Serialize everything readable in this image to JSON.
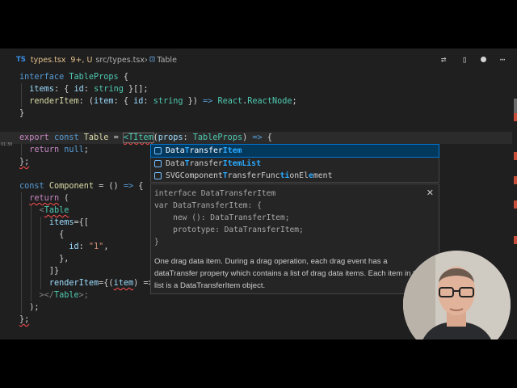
{
  "colors": {
    "editor_bg": "#1f1f1f",
    "keyword": "#569cd6",
    "type": "#4ec9b0",
    "selection": "#04395e",
    "error_marker": "#c74e39"
  },
  "breadcrumb": {
    "lang_badge": "TS",
    "filename": "types.tsx",
    "status": "9+, U",
    "path": "src/types.tsx",
    "separator": "›",
    "symbol_icon": "⊡",
    "symbol": "Table"
  },
  "tab_actions": [
    {
      "name": "compare-changes-icon",
      "glyph": "⇄"
    },
    {
      "name": "split-editor-icon",
      "glyph": "▯"
    },
    {
      "name": "unsaved-dot-icon",
      "glyph": ""
    },
    {
      "name": "more-actions-icon",
      "glyph": "⋯"
    }
  ],
  "code": {
    "l1": {
      "kw": "interface",
      "sp": " ",
      "name": "TableProps",
      "rest": " {"
    },
    "l2": {
      "indent": "  ",
      "p": "items",
      "t1": ": { ",
      "p2": "id",
      "t2": ": ",
      "ty": "string",
      "t3": " }[];"
    },
    "l3": {
      "indent": "  ",
      "fn": "renderItem",
      "t1": ": (",
      "p": "item",
      "t2": ": { ",
      "p2": "id",
      "t3": ": ",
      "ty": "string",
      "t4": " }) ",
      "arrow": "=>",
      "t5": " ",
      "ns": "React",
      "dot": ".",
      "rn": "ReactNode",
      "end": ";"
    },
    "l4": {
      "text": "}"
    },
    "l5": {
      "kw1": "export",
      "kw2": "const",
      "name": "Table",
      "eq": " = ",
      "typed": "<TItem",
      "rest1": "(",
      "p": "props",
      "rest2": ": ",
      "ty": "TableProps",
      "rest3": ") ",
      "arrow": "=>",
      "rest4": " {",
      "time": "01:30"
    },
    "l6": {
      "indent": "  ",
      "kw": "return",
      "sp": " ",
      "val": "null",
      "end": ";"
    },
    "l7": {
      "text": "};"
    },
    "l8": {
      "kw": "const",
      "name": "Component",
      "rest": " = () ",
      "arrow": "=>",
      "end": " {"
    },
    "l9": {
      "indent": "  ",
      "kw": "return",
      "end": " ("
    },
    "l10": {
      "indent": "    ",
      "lt": "<",
      "tag": "Table"
    },
    "l11": {
      "indent": "      ",
      "attr": "items",
      "rest": "={["
    },
    "l12": {
      "indent": "        ",
      "text": "{"
    },
    "l13": {
      "indent": "          ",
      "p": "id",
      "colon": ": ",
      "str": "\"1\"",
      "end": ","
    },
    "l14": {
      "indent": "        ",
      "text": "},"
    },
    "l15": {
      "indent": "      ",
      "text": "]}"
    },
    "l16": {
      "indent": "      ",
      "attr": "renderItem",
      "rest": "={(",
      "p": "item",
      "end": ") =>"
    },
    "l17": {
      "indent": "    ",
      "close1": "></",
      "tag": "Table",
      "close2": ">;"
    },
    "l18": {
      "indent": "  ",
      "text": ");"
    },
    "l19": {
      "text": "};"
    }
  },
  "suggestions": [
    {
      "pre": "Data",
      "m1": "T",
      "mid": "ransfer",
      "m2": "Item",
      "post": "",
      "selected": true
    },
    {
      "pre": "Data",
      "m1": "T",
      "mid": "ransfer",
      "m2": "ItemList",
      "post": "",
      "selected": false
    },
    {
      "pre": "SVGComponent",
      "m1": "T",
      "mid": "ransferFunc",
      "m2": "ti",
      "post": "onEl",
      "m3": "e",
      "post2": "ment",
      "selected": false
    }
  ],
  "details": {
    "signature": "interface DataTransferItem\nvar DataTransferItem: {\n    new (): DataTransferItem;\n    prototype: DataTransferItem;\n}",
    "doc": "One drag data item. During a drag operation, each drag event has a dataTransfer property which contains a list of drag data items. Each item in the list is a DataTransferItem object.",
    "close": "✕"
  }
}
